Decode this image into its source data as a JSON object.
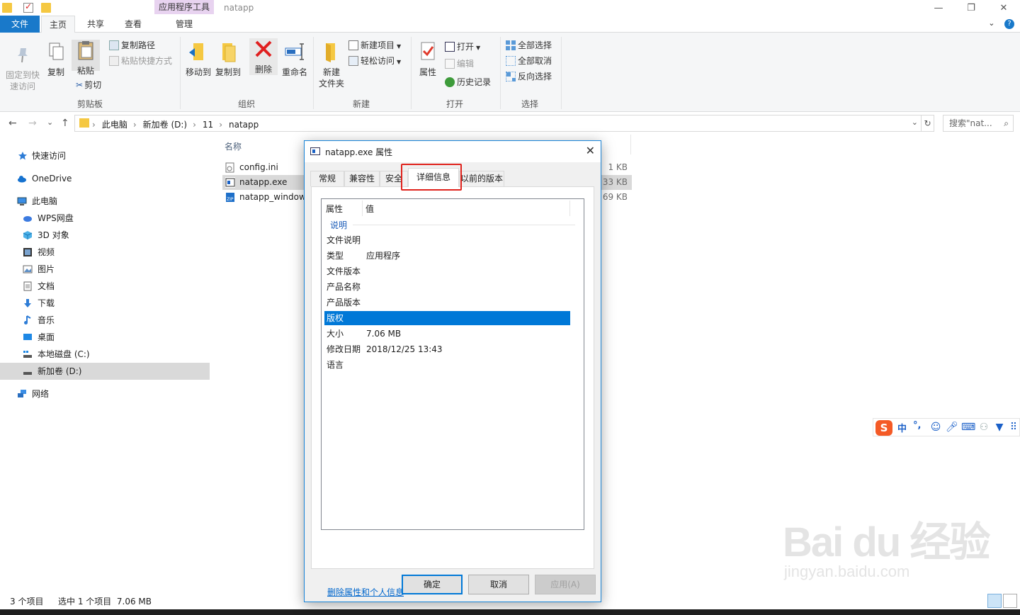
{
  "window": {
    "title": "natapp",
    "context_tab_header": "应用程序工具",
    "minimize": "—",
    "restore": "❐",
    "close": "✕"
  },
  "ribbon_tabs": {
    "file": "文件",
    "home": "主页",
    "share": "共享",
    "view": "查看",
    "manage": "管理",
    "expand": "⌄",
    "help": "?"
  },
  "ribbon": {
    "pin": "固定到快\n速访问",
    "pin_line1": "固定到快",
    "pin_line2": "速访问",
    "copy": "复制",
    "paste": "粘贴",
    "copy_path": "复制路径",
    "paste_shortcut": "粘贴快捷方式",
    "cut": "剪切",
    "group_clipboard": "剪贴板",
    "move_to": "移动到",
    "copy_to": "复制到",
    "delete": "删除",
    "rename": "重命名",
    "group_organize": "组织",
    "new_folder_line1": "新建",
    "new_folder_line2": "文件夹",
    "new_item": "新建项目",
    "easy_access": "轻松访问",
    "group_new": "新建",
    "properties": "属性",
    "open": "打开",
    "edit": "编辑",
    "history": "历史记录",
    "group_open": "打开",
    "select_all": "全部选择",
    "select_none": "全部取消",
    "invert_selection": "反向选择",
    "group_select": "选择"
  },
  "nav": {
    "back": "←",
    "forward": "→",
    "recent": "⌄",
    "up": "↑",
    "breadcrumbs": [
      "此电脑",
      "新加卷 (D:)",
      "11",
      "natapp"
    ],
    "crumb_sep": "›",
    "dropdown": "⌄",
    "refresh": "↻",
    "search_placeholder": "搜索\"nat...",
    "search_icon": "⌕"
  },
  "sidebar": {
    "items": [
      {
        "label": "快速访问",
        "icon": "star-icon"
      },
      {
        "label": "OneDrive",
        "icon": "cloud-icon"
      },
      {
        "label": "此电脑",
        "icon": "pc-icon"
      },
      {
        "label": "WPS网盘",
        "icon": "wps-cloud-icon"
      },
      {
        "label": "3D 对象",
        "icon": "cube-icon"
      },
      {
        "label": "视频",
        "icon": "video-icon"
      },
      {
        "label": "图片",
        "icon": "picture-icon"
      },
      {
        "label": "文档",
        "icon": "document-icon"
      },
      {
        "label": "下载",
        "icon": "download-icon"
      },
      {
        "label": "音乐",
        "icon": "music-icon"
      },
      {
        "label": "桌面",
        "icon": "desktop-icon"
      },
      {
        "label": "本地磁盘 (C:)",
        "icon": "drive-icon"
      },
      {
        "label": "新加卷 (D:)",
        "icon": "drive-icon"
      },
      {
        "label": "网络",
        "icon": "network-icon"
      }
    ]
  },
  "files": {
    "col_name": "名称",
    "rows": [
      {
        "name": "config.ini",
        "size": "1 KB"
      },
      {
        "name": "natapp.exe",
        "size": "33 KB"
      },
      {
        "name": "natapp_window",
        "size": "69 KB"
      }
    ]
  },
  "status": {
    "count": "3 个项目",
    "selection": "选中 1 个项目  7.06 MB"
  },
  "ime": {
    "logo": "S",
    "lang": "中",
    "punct": "°,"
  },
  "watermark": {
    "text": "Bai  du 经验",
    "url": "jingyan.baidu.com"
  },
  "dialog": {
    "title": "natapp.exe 属性",
    "close": "✕",
    "tabs": [
      "常规",
      "兼容性",
      "安全",
      "详细信息",
      "以前的版本"
    ],
    "active_tab": "详细信息",
    "col_property": "属性",
    "col_value": "值",
    "group": "说明",
    "rows": [
      {
        "key": "文件说明",
        "value": ""
      },
      {
        "key": "类型",
        "value": "应用程序"
      },
      {
        "key": "文件版本",
        "value": ""
      },
      {
        "key": "产品名称",
        "value": ""
      },
      {
        "key": "产品版本",
        "value": ""
      },
      {
        "key": "版权",
        "value": ""
      },
      {
        "key": "大小",
        "value": "7.06 MB"
      },
      {
        "key": "修改日期",
        "value": "2018/12/25 13:43"
      },
      {
        "key": "语言",
        "value": ""
      }
    ],
    "remove_link": "删除属性和个人信息",
    "ok": "确定",
    "cancel": "取消",
    "apply": "应用(A)"
  }
}
